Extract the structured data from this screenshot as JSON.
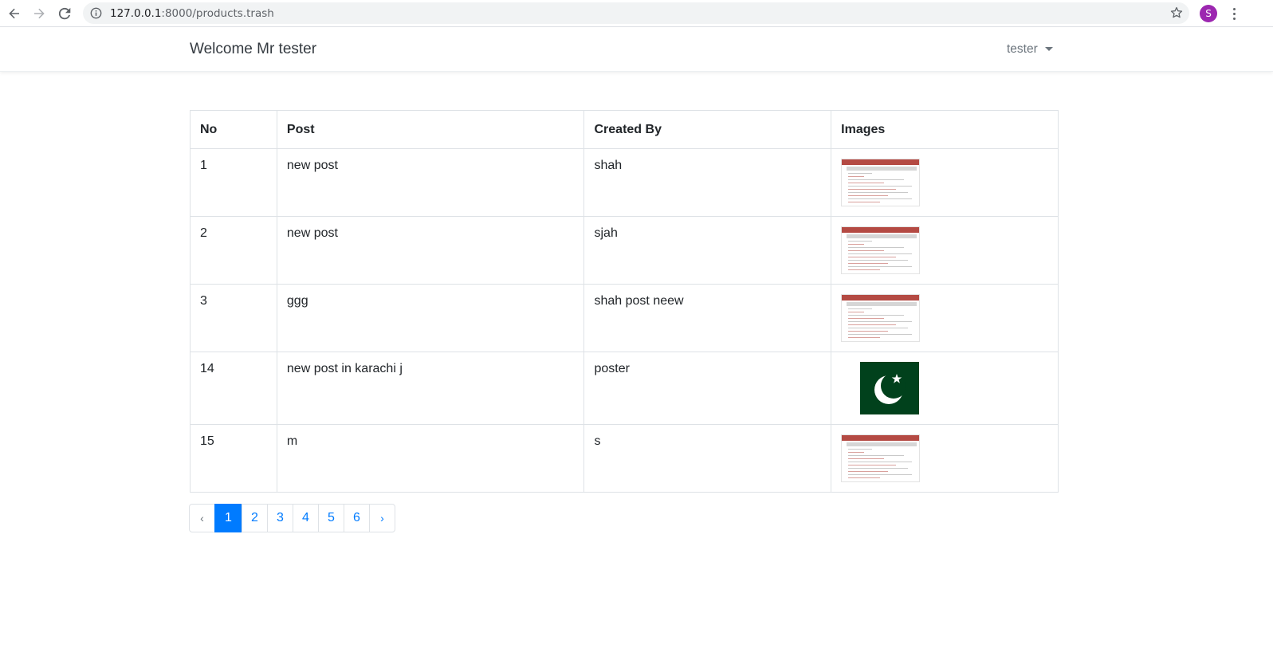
{
  "browser": {
    "url_host": "127.0.0.1",
    "url_rest": ":8000/products.trash",
    "avatar_letter": "S",
    "avatar_color": "#9c27b0"
  },
  "navbar": {
    "brand": "Welcome Mr tester",
    "user": "tester"
  },
  "table": {
    "headers": [
      "No",
      "Post",
      "Created By",
      "Images"
    ],
    "rows": [
      {
        "no": "1",
        "post": "new post",
        "created_by": "shah",
        "image": "screenshot-thumbnail"
      },
      {
        "no": "2",
        "post": "new post",
        "created_by": "sjah",
        "image": "screenshot-thumbnail"
      },
      {
        "no": "3",
        "post": "ggg",
        "created_by": "shah post neew",
        "image": "screenshot-thumbnail"
      },
      {
        "no": "14",
        "post": "new post in karachi j",
        "created_by": "poster",
        "image": "pakistan-flag"
      },
      {
        "no": "15",
        "post": "m",
        "created_by": "s",
        "image": "screenshot-thumbnail"
      }
    ]
  },
  "pagination": {
    "prev": "‹",
    "pages": [
      "1",
      "2",
      "3",
      "4",
      "5",
      "6"
    ],
    "active": "1",
    "next": "›",
    "accent": "#007bff"
  }
}
